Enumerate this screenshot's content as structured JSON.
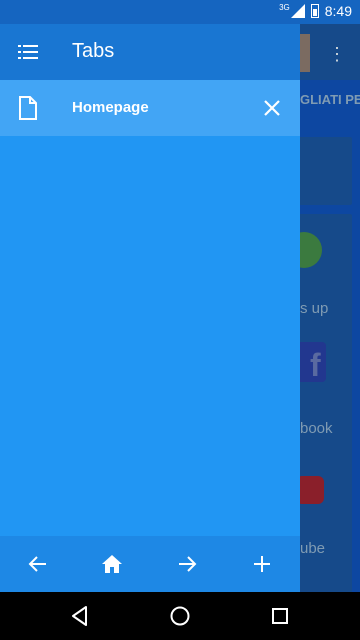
{
  "status_bar": {
    "network": "3G",
    "time": "8:49"
  },
  "background_app": {
    "banner_text": "GLIATI PE",
    "items": [
      {
        "label": "s up",
        "icon": "whatsapp-icon"
      },
      {
        "label": "book",
        "icon": "facebook-icon"
      },
      {
        "label": "ube",
        "icon": "youtube-icon"
      }
    ]
  },
  "drawer": {
    "title": "Tabs",
    "tabs": [
      {
        "title": "Homepage",
        "icon": "document-icon"
      }
    ],
    "bottom_bar": {
      "buttons": [
        "back-arrow-icon",
        "home-icon",
        "forward-arrow-icon",
        "add-icon"
      ]
    }
  },
  "navigation_bar": {
    "buttons": [
      "back-triangle-icon",
      "home-circle-icon",
      "recents-square-icon"
    ]
  },
  "colors": {
    "drawer_bg": "#2196f3",
    "drawer_header": "#1976d2",
    "tab_row": "#42a5f5",
    "bottom_bar": "#1e88e5"
  }
}
